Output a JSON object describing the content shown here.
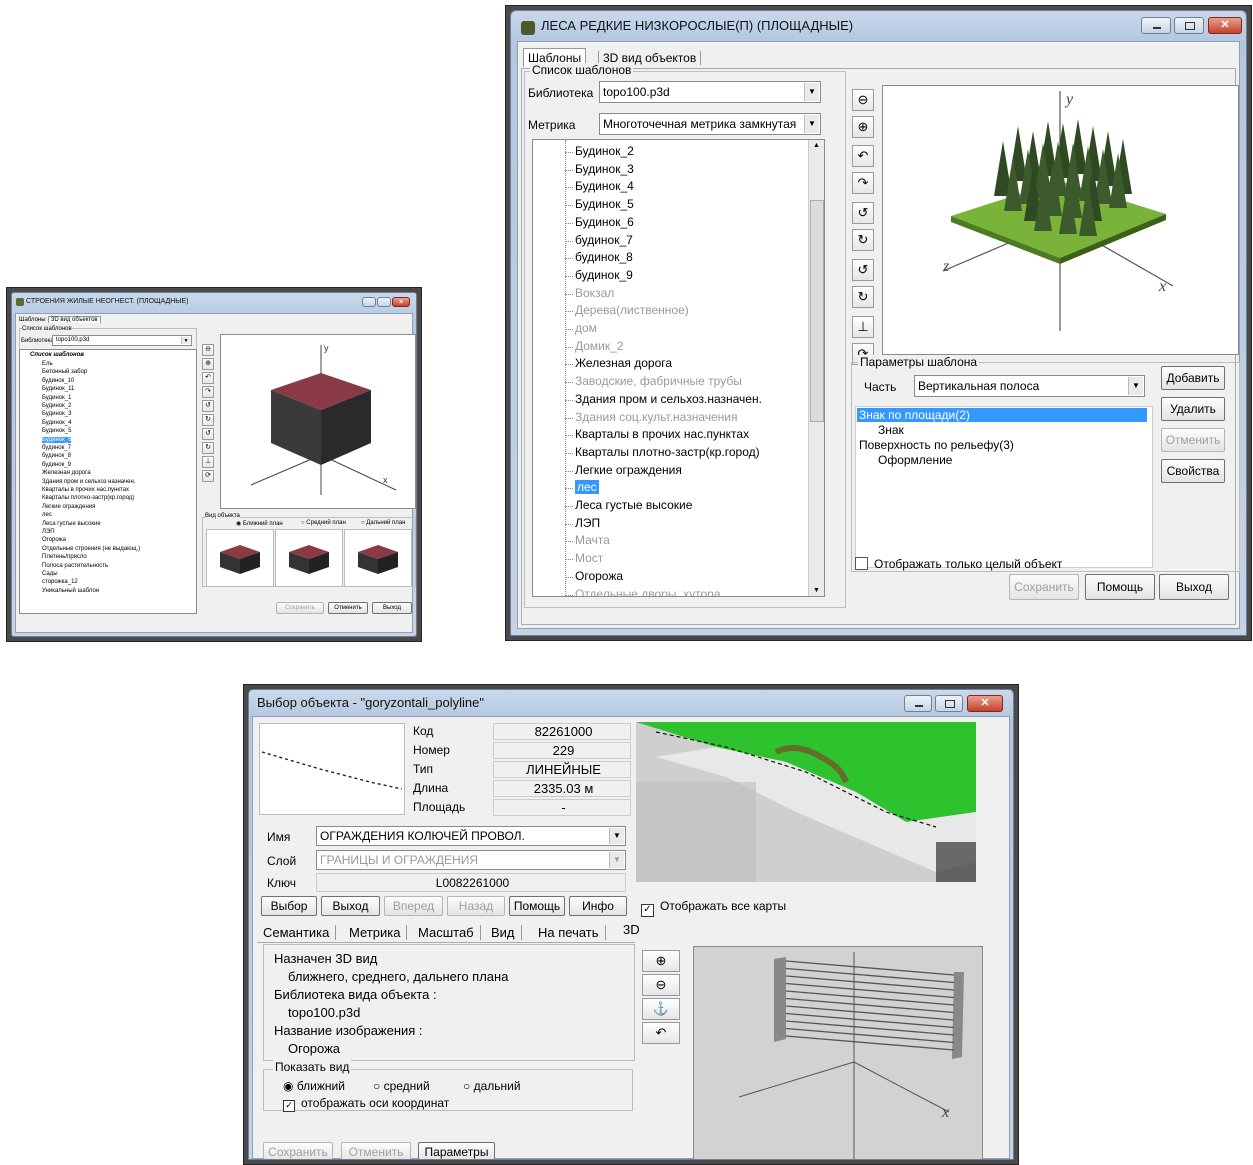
{
  "win_small": {
    "title": "СТРОЕНИЯ ЖИЛЫЕ НЕОГНЕСТ. (ПЛОЩАДНЫЕ)",
    "tabs": [
      "Шаблоны",
      "3D вид объектов"
    ],
    "group_label": "Список шаблонов",
    "library_label": "Библиотека",
    "library_value": "topo100.p3d",
    "tree_root": "Список шаблонов",
    "tree_items": [
      "Ель",
      "Бетонный забор",
      "будинок_10",
      "Будинок_11",
      "Будинок_1",
      "Будинок_2",
      "Будинок_3",
      "Будинок_4",
      "Будинок_5",
      "Будинок_6",
      "будинок_7",
      "будинок_8",
      "будинок_9",
      "Железная дорога",
      "Здания пром и сельхоз назначен.",
      "Кварталы в прочих нас.пунктах",
      "Кварталы плотно-застр(кр.город)",
      "Легкие ограждения",
      "лес",
      "Леса густые высокие",
      "ЛЭП",
      "Огорожа",
      "Отдельные строения (не выдающ.)",
      "Плетень/прясло",
      "Полоса растительность",
      "Сады",
      "сторожка_12",
      "Уникальный шаблон"
    ],
    "tree_selected": "Будинок_6",
    "view_group": "Вид объекта",
    "radios": [
      "Ближний план",
      "Средний план",
      "Дальний план"
    ],
    "buttons": [
      "Сохранить",
      "Отменить",
      "Выход"
    ]
  },
  "win_top": {
    "title": "ЛЕСА РЕДКИЕ НИЗКОРОСЛЫЕ(П) (ПЛОЩАДНЫЕ)",
    "tabs": [
      "Шаблоны",
      "3D вид объектов"
    ],
    "group_label": "Список шаблонов",
    "library_label": "Библиотека",
    "library_value": "topo100.p3d",
    "metric_label": "Метрика",
    "metric_value": "Многоточечная метрика замкнутая",
    "tree_items": [
      {
        "text": "Будинок_2",
        "dim": false
      },
      {
        "text": "Будинок_3",
        "dim": false
      },
      {
        "text": "Будинок_4",
        "dim": false
      },
      {
        "text": "Будинок_5",
        "dim": false
      },
      {
        "text": "Будинок_6",
        "dim": false
      },
      {
        "text": "будинок_7",
        "dim": false
      },
      {
        "text": "будинок_8",
        "dim": false
      },
      {
        "text": "будинок_9",
        "dim": false
      },
      {
        "text": "Вокзал",
        "dim": true
      },
      {
        "text": "Дерева(лиственное)",
        "dim": true
      },
      {
        "text": "дом",
        "dim": true
      },
      {
        "text": "Домик_2",
        "dim": true
      },
      {
        "text": "Железная дорога",
        "dim": false
      },
      {
        "text": "Заводские, фабричные трубы",
        "dim": true
      },
      {
        "text": "Здания пром и сельхоз.назначен.",
        "dim": false
      },
      {
        "text": "Здания соц.культ.назначения",
        "dim": true
      },
      {
        "text": "Кварталы в прочих нас.пунктах",
        "dim": false
      },
      {
        "text": "Кварталы плотно-застр(кр.город)",
        "dim": false
      },
      {
        "text": "Легкие ограждения",
        "dim": false
      },
      {
        "text": "лес",
        "dim": false
      },
      {
        "text": "Леса густые высокие",
        "dim": false
      },
      {
        "text": "ЛЭП",
        "dim": false
      },
      {
        "text": "Мачта",
        "dim": true
      },
      {
        "text": "Мост",
        "dim": true
      },
      {
        "text": "Огорожа",
        "dim": false
      },
      {
        "text": "Отдельные дворы, хутора",
        "dim": true
      }
    ],
    "tree_selected": "лес",
    "params_label": "Параметры шаблона",
    "part_label": "Часть",
    "part_value": "Вертикальная полоса",
    "params_list": [
      {
        "text": "Знак по площади(2)",
        "indent": false,
        "selected": true
      },
      {
        "text": "Знак",
        "indent": true,
        "selected": false
      },
      {
        "text": "Поверхность по рельефу(3)",
        "indent": false,
        "selected": false
      },
      {
        "text": "Оформление",
        "indent": true,
        "selected": false
      }
    ],
    "side_buttons": [
      {
        "label": "Добавить",
        "disabled": false
      },
      {
        "label": "Удалить",
        "disabled": false
      },
      {
        "label": "Отменить",
        "disabled": true
      },
      {
        "label": "Свойства",
        "disabled": false
      }
    ],
    "checkbox_label": "Отображать только целый объект",
    "bottom_buttons": [
      {
        "label": "Сохранить",
        "disabled": true
      },
      {
        "label": "Помощь",
        "disabled": false
      },
      {
        "label": "Выход",
        "disabled": false
      }
    ],
    "axis_y": "y",
    "axis_x": "x",
    "axis_z": "z"
  },
  "win_bottom": {
    "title": "Выбор объекта - \"goryzontali_polyline\"",
    "props": [
      {
        "label": "Код",
        "value": "82261000"
      },
      {
        "label": "Номер",
        "value": "229"
      },
      {
        "label": "Тип",
        "value": "ЛИНЕЙНЫЕ"
      },
      {
        "label": "Длина",
        "value": "2335.03  м"
      },
      {
        "label": "Площадь",
        "value": "-"
      }
    ],
    "name_label": "Имя",
    "name_value": "ОГРАЖДЕНИЯ КОЛЮЧЕЙ ПРОВОЛ.",
    "layer_label": "Слой",
    "layer_value": "ГРАНИЦЫ И ОГРАЖДЕНИЯ",
    "key_label": "Ключ",
    "key_value": "L0082261000",
    "buttons": [
      {
        "label": "Выбор",
        "disabled": false
      },
      {
        "label": "Выход",
        "disabled": false
      },
      {
        "label": "Вперед",
        "disabled": true
      },
      {
        "label": "Назад",
        "disabled": true
      },
      {
        "label": "Помощь",
        "disabled": false
      },
      {
        "label": "Инфо",
        "disabled": false
      }
    ],
    "show_all_maps": "Отображать все карты",
    "tabs": [
      "Семантика",
      "Метрика",
      "Масштаб",
      "Вид",
      "На печать",
      "3D"
    ],
    "info_lines": [
      {
        "text": "Назначен 3D вид",
        "indent": false
      },
      {
        "text": "ближнего, среднего, дальнего плана",
        "indent": true
      },
      {
        "text": "Библиотека вида объекта :",
        "indent": false
      },
      {
        "text": "topo100.p3d",
        "indent": true
      },
      {
        "text": "Название изображения :",
        "indent": false
      },
      {
        "text": "Огорожа",
        "indent": true
      }
    ],
    "show_view_label": "Показать вид",
    "radios": [
      "ближний",
      "средний",
      "дальний"
    ],
    "axes_checkbox": "отображать оси координат",
    "bottom_buttons": [
      {
        "label": "Сохранить",
        "disabled": true
      },
      {
        "label": "Отменить",
        "disabled": true
      },
      {
        "label": "Параметры",
        "disabled": false
      }
    ],
    "axis_x": "x"
  }
}
